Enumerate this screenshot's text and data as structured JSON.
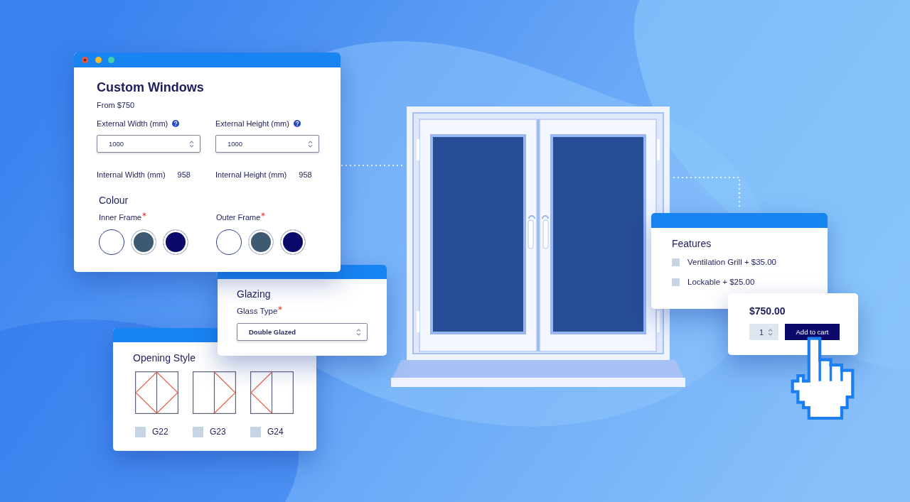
{
  "product_card": {
    "title": "Custom Windows",
    "price": "From $750",
    "external": [
      {
        "label": "External Width (mm)",
        "value": "1000"
      },
      {
        "label": "External Height (mm)",
        "value": "1000"
      }
    ],
    "internal": [
      {
        "label": "Internal Width (mm)",
        "value": "958"
      },
      {
        "label": "Internal Height (mm)",
        "value": "958"
      }
    ],
    "colour": {
      "heading": "Colour",
      "frames": [
        {
          "label": "Inner Frame",
          "required": true,
          "swatches": [
            {
              "color": "#ffffff",
              "selected": true
            },
            {
              "color": "#3d5a72",
              "selected": false
            },
            {
              "color": "#0b0a6b",
              "selected": false
            }
          ]
        },
        {
          "label": "Outer Frame",
          "required": true,
          "swatches": [
            {
              "color": "#ffffff",
              "selected": true
            },
            {
              "color": "#3d5a72",
              "selected": false
            },
            {
              "color": "#0b0a6b",
              "selected": false
            }
          ]
        }
      ]
    }
  },
  "glazing_card": {
    "title": "Glazing",
    "label": "Glass Type",
    "required": true,
    "value": "Double Glazed"
  },
  "opening_style_card": {
    "title": "Opening Style",
    "options": [
      {
        "kind": "both",
        "label": "G22",
        "checked": false
      },
      {
        "kind": "right",
        "label": "G23",
        "checked": false
      },
      {
        "kind": "left",
        "label": "G24",
        "checked": false
      }
    ]
  },
  "features_card": {
    "title": "Features",
    "options": [
      {
        "label": "Ventilation Grill + $35.00",
        "checked": false
      },
      {
        "label": "Lockable + $25.00",
        "checked": false
      }
    ]
  },
  "cart_card": {
    "price": "$750.00",
    "quantity": "1",
    "button": "Add to cart"
  }
}
